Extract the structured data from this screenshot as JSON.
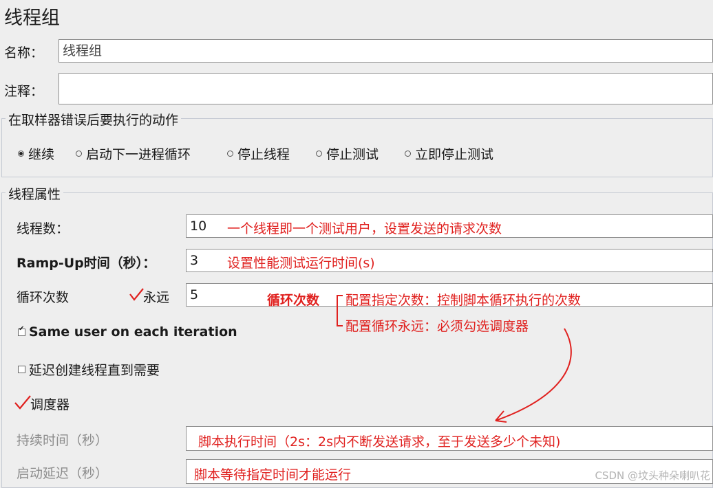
{
  "panel": {
    "title": "线程组"
  },
  "name_row": {
    "label": "名称：",
    "value": "线程组"
  },
  "comment_row": {
    "label": "注释：",
    "value": ""
  },
  "sampler_error": {
    "legend": "在取样器错误后要执行的动作",
    "options": [
      {
        "label": "继续",
        "selected": true
      },
      {
        "label": "启动下一进程循环",
        "selected": false
      },
      {
        "label": "停止线程",
        "selected": false
      },
      {
        "label": "停止测试",
        "selected": false
      },
      {
        "label": "立即停止测试",
        "selected": false
      }
    ]
  },
  "thread_props": {
    "legend": "线程属性",
    "threads": {
      "label": "线程数：",
      "value": "10"
    },
    "rampup": {
      "label": "Ramp-Up时间（秒）：",
      "value": "3"
    },
    "loops": {
      "label": "循环次数",
      "forever_label": "永远",
      "forever_checked": true,
      "value": "5"
    },
    "same_user": {
      "label": "Same user on each iteration",
      "checked": true
    },
    "delay_create": {
      "label": "延迟创建线程直到需要",
      "checked": false
    },
    "scheduler": {
      "label": "调度器",
      "checked": true
    },
    "duration": {
      "label": "持续时间（秒）",
      "value": ""
    },
    "startup_delay": {
      "label": "启动延迟（秒）",
      "value": ""
    }
  },
  "annotations": {
    "threads": "一个线程即一个测试用户，设置发送的请求次数",
    "rampup": "设置性能测试运行时间(s)",
    "loops_title": "循环次数",
    "loops_a": "配置指定次数：控制脚本循环执行的次数",
    "loops_b": "配置循环永远：必须勾选调度器",
    "duration": "脚本执行时间（2s：2s内不断发送请求，至于发送多少个未知)",
    "startup_delay": "脚本等待指定时间才能运行"
  },
  "watermark": "CSDN @坟头种朵喇叭花",
  "colors": {
    "annotation": "#e0211f",
    "background": "#eeeeee"
  }
}
